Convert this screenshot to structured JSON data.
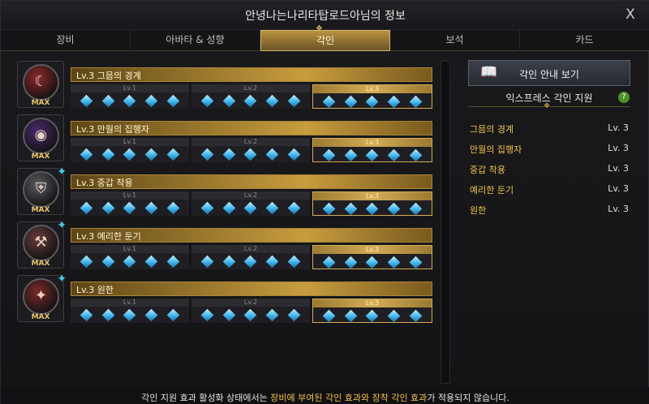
{
  "window": {
    "title": "안녕나는나리타탑로드아님의 정보",
    "close_label": "X"
  },
  "tabs": [
    {
      "label": "장비",
      "active": false
    },
    {
      "label": "아바타 & 성향",
      "active": false
    },
    {
      "label": "각인",
      "active": true
    },
    {
      "label": "보석",
      "active": false
    },
    {
      "label": "카드",
      "active": false
    }
  ],
  "engravings": [
    {
      "name": "Lv.3 그믐의 경계",
      "max_label": "MAX",
      "level_labels": [
        "Lv.1",
        "Lv.2",
        "Lv.3"
      ],
      "current_level": 3,
      "icon": "crescent-moon-icon",
      "icon_color": "#8c2a2a"
    },
    {
      "name": "Lv.3 만월의 집행자",
      "max_label": "MAX",
      "level_labels": [
        "Lv.1",
        "Lv.2",
        "Lv.3"
      ],
      "current_level": 3,
      "icon": "full-moon-icon",
      "icon_color": "#4a2a6a"
    },
    {
      "name": "Lv.3 중갑 착용",
      "max_label": "MAX",
      "level_labels": [
        "Lv.1",
        "Lv.2",
        "Lv.3"
      ],
      "current_level": 3,
      "icon": "heavy-armor-icon",
      "icon_color": "#5a5d62"
    },
    {
      "name": "Lv.3 예리한 둔기",
      "max_label": "MAX",
      "level_labels": [
        "Lv.1",
        "Lv.2",
        "Lv.3"
      ],
      "current_level": 3,
      "icon": "blunt-weapon-icon",
      "icon_color": "#6a3a3a"
    },
    {
      "name": "Lv.3 원한",
      "max_label": "MAX",
      "level_labels": [
        "Lv.1",
        "Lv.2",
        "Lv.3"
      ],
      "current_level": 3,
      "icon": "grudge-icon",
      "icon_color": "#7a2a2a"
    }
  ],
  "side": {
    "guide_button": "각인 안내 보기",
    "express_title": "익스프레스 각인 지원",
    "help_label": "?",
    "express_items": [
      {
        "name": "그믐의 경계",
        "level": "Lv. 3"
      },
      {
        "name": "만월의 집행자",
        "level": "Lv. 3"
      },
      {
        "name": "중갑 착용",
        "level": "Lv. 3"
      },
      {
        "name": "예리한 둔기",
        "level": "Lv. 3"
      },
      {
        "name": "원한",
        "level": "Lv. 3"
      }
    ]
  },
  "notice": {
    "part1": "각인 지원 효과 활성화 상태에서는 ",
    "part2": "장비에 부여된 각인 효과와 장착 각인 효과",
    "part3": "가 적용되지 않습니다."
  },
  "colors": {
    "accent_gold": "#d4ac55",
    "gem_blue": "#3fb3ea",
    "express_name": "#f0c24a"
  }
}
